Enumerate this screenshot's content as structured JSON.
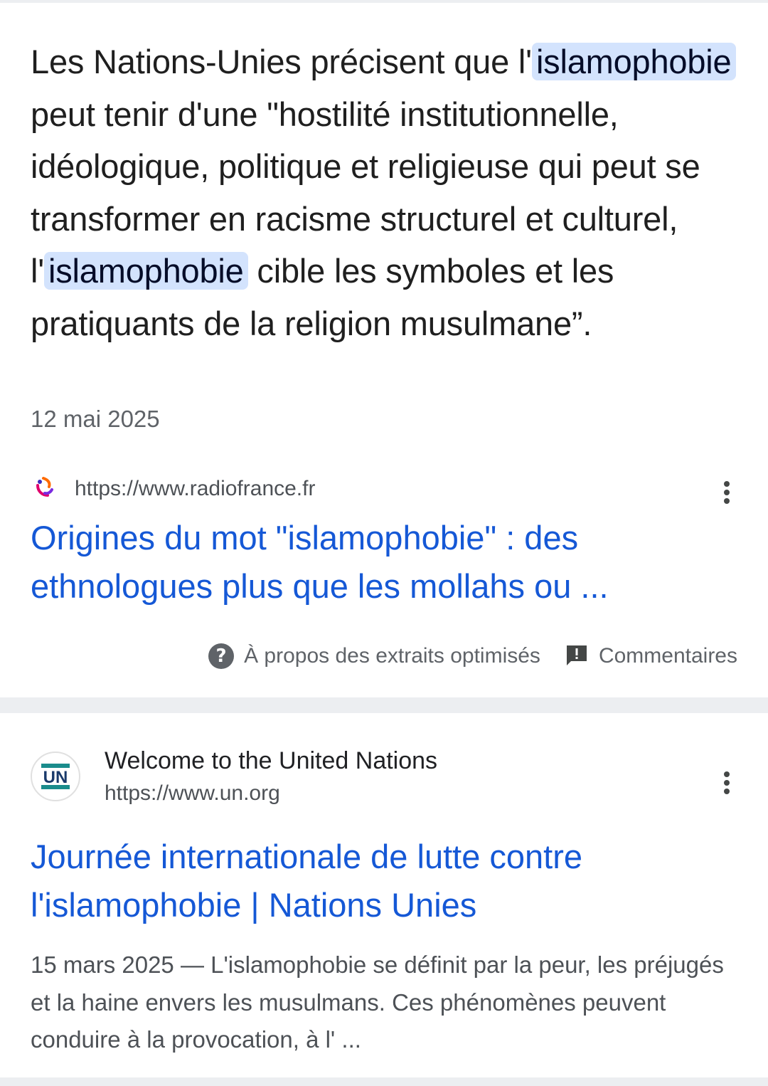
{
  "featured_snippet": {
    "text_parts": {
      "p1": "Les Nations-Unies précisent que l'",
      "h1": "islamophobie",
      "p2": " peut tenir d'une \"hostilité institutionnelle, idéologique, politique et religieuse qui peut se transformer en racisme structurel et culturel, l'",
      "h2": "islamophobie",
      "p3": " cible les symboles et les pratiquants de la religion musulmane”."
    },
    "date": "12 mai 2025",
    "source_url": "https://www.radiofrance.fr",
    "title": "Origines du mot \"islamophobie\" : des ethnologues plus que les mollahs ou ...",
    "about_label": "À propos des extraits optimisés",
    "feedback_label": "Commentaires"
  },
  "result_un": {
    "site_name": "Welcome to the United Nations",
    "site_url": "https://www.un.org",
    "logo_text": "UN",
    "title": "Journée internationale de lutte contre l'islamophobie | Nations Unies",
    "description": "15 mars 2025 — L'islamophobie se définit par la peur, les préjugés et la haine envers les musulmans. Ces phénomènes peuvent conduire à la provocation, à l' ..."
  },
  "icons": {
    "more": "more-vert-icon",
    "help": "help-circle-icon",
    "feedback": "feedback-icon",
    "radiofrance": "radiofrance-logo",
    "un": "un-logo"
  },
  "colors": {
    "link": "#1558d6",
    "highlight": "#d3e3fd",
    "separator": "#eceef1",
    "secondary_text": "#5f6368",
    "un_teal": "#1a8c8c",
    "un_navy": "#1a3a6b"
  }
}
